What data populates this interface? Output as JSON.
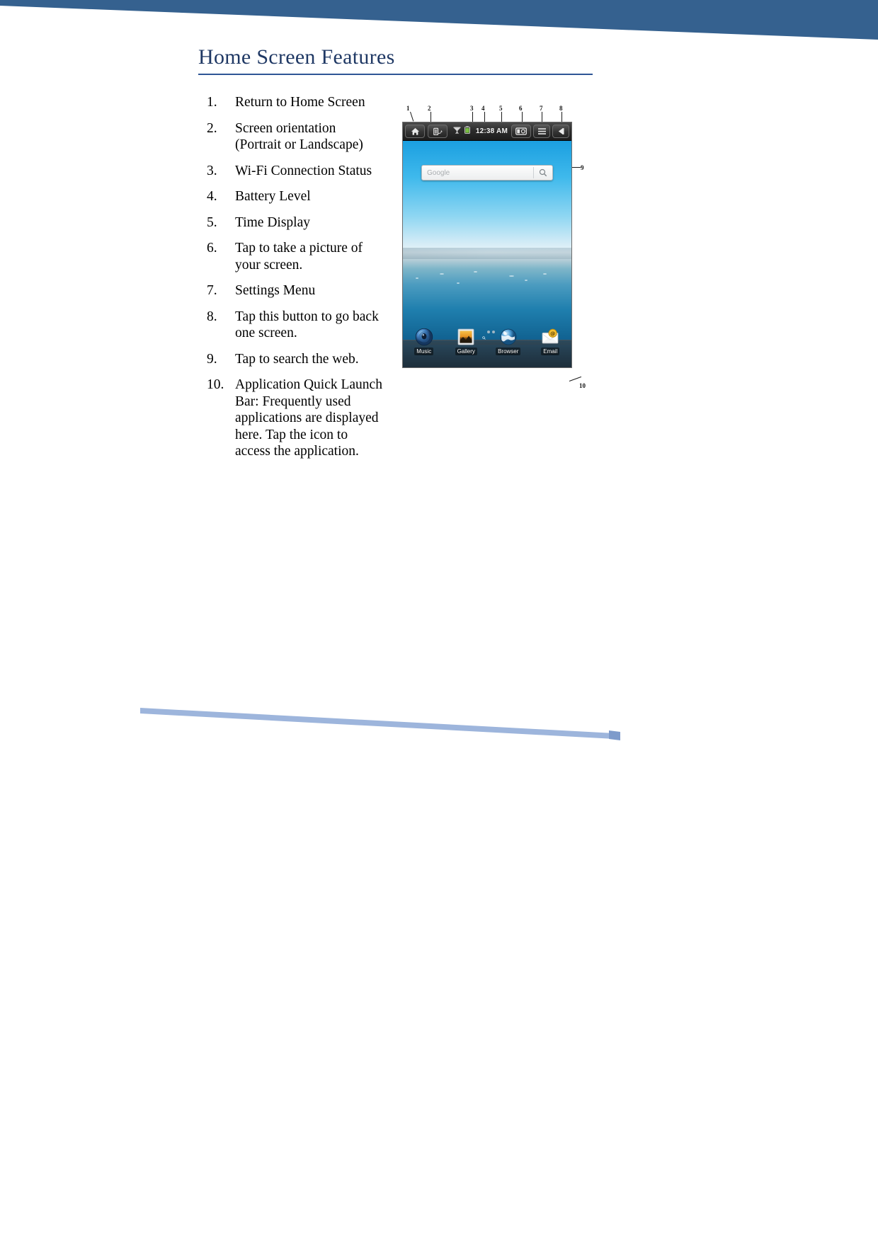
{
  "page": {
    "heading": "Home Screen Features",
    "accent_color": "#35618F",
    "heading_color": "#1F3864",
    "rule_color": "#2E5596",
    "swoosh_color": "#9DB5DC"
  },
  "features": [
    {
      "num": "1.",
      "text": "Return to Home Screen"
    },
    {
      "num": "2.",
      "text": "Screen orientation (Portrait or Landscape)"
    },
    {
      "num": "3.",
      "text": "Wi-Fi Connection Status"
    },
    {
      "num": "4.",
      "text": "Battery Level"
    },
    {
      "num": "5.",
      "text": "Time Display"
    },
    {
      "num": "6.",
      "text": "Tap to take a picture of your screen."
    },
    {
      "num": "7.",
      "text": "Settings Menu"
    },
    {
      "num": "8.",
      "text": "Tap this button to go back one screen."
    },
    {
      "num": "9.",
      "text": "Tap to search the web."
    },
    {
      "num": "10.",
      "text": "Application Quick Launch Bar: Frequently used applications are displayed here. Tap the icon to access the application."
    }
  ],
  "figure": {
    "callouts": [
      "1",
      "2",
      "3",
      "4",
      "5",
      "6",
      "7",
      "8",
      "9",
      "10"
    ],
    "statusbar": {
      "home_icon": "home-icon",
      "rotation_icon": "screen-rotation-icon",
      "wifi_icon": "wifi-icon",
      "battery_icon": "battery-icon",
      "time": "12:38 AM",
      "screenshot_icon": "camera-icon",
      "menu_icon": "menu-icon",
      "back_icon": "back-arrow-icon"
    },
    "search_widget": {
      "placeholder": "Google",
      "search_icon": "magnifier-icon"
    },
    "dock": [
      {
        "label": "Music",
        "icon": "music-icon"
      },
      {
        "label": "Gallery",
        "icon": "gallery-icon"
      },
      {
        "label": "Browser",
        "icon": "browser-globe-icon"
      },
      {
        "label": "Email",
        "icon": "email-envelope-icon"
      }
    ]
  }
}
